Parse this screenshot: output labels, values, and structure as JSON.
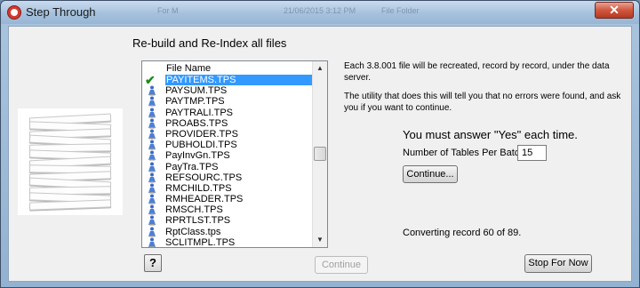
{
  "window": {
    "title": "Step Through",
    "close_symbol": "✕",
    "background_labels": [
      "For M",
      "21/06/2015 3:12 PM",
      "File Folder"
    ]
  },
  "heading": "Re-build and Re-Index all files",
  "file_list": {
    "header": "File Name",
    "items": [
      {
        "name": "PAYITEMS.TPS",
        "selected": true,
        "checked": true
      },
      {
        "name": "PAYSUM.TPS"
      },
      {
        "name": "PAYTMP.TPS"
      },
      {
        "name": "PAYTRALI.TPS"
      },
      {
        "name": "PROABS.TPS"
      },
      {
        "name": "PROVIDER.TPS"
      },
      {
        "name": "PUBHOLDI.TPS"
      },
      {
        "name": "PayInvGn.TPS"
      },
      {
        "name": "PayTra.TPS"
      },
      {
        "name": "REFSOURC.TPS"
      },
      {
        "name": "RMCHILD.TPS"
      },
      {
        "name": "RMHEADER.TPS"
      },
      {
        "name": "RMSCH.TPS"
      },
      {
        "name": "RPRTLST.TPS"
      },
      {
        "name": "RptClass.tps"
      },
      {
        "name": "SCLITMPL.TPS"
      }
    ],
    "scroll_up": "▲",
    "scroll_down": "▼"
  },
  "info": {
    "line1a": "Each 3.8.001 file will be recreated, record by record, under the data",
    "line1b": "server.",
    "line2a": "The utility that does this will tell you that no errors were found, and ask",
    "line2b": "you if you want to continue.",
    "must_answer": "You must answer \"Yes\" each time.",
    "batch_label": "Number of Tables Per Batch:",
    "batch_value": "15",
    "continue_label": "Continue...",
    "status": "Converting record 60 of 89."
  },
  "footer": {
    "help_label": "?",
    "continue_disabled_label": "Continue",
    "stop_label": "Stop For Now"
  },
  "colors": {
    "selection": "#3399ff",
    "check": "#1d8a1d",
    "close_button": "#d0573f"
  }
}
